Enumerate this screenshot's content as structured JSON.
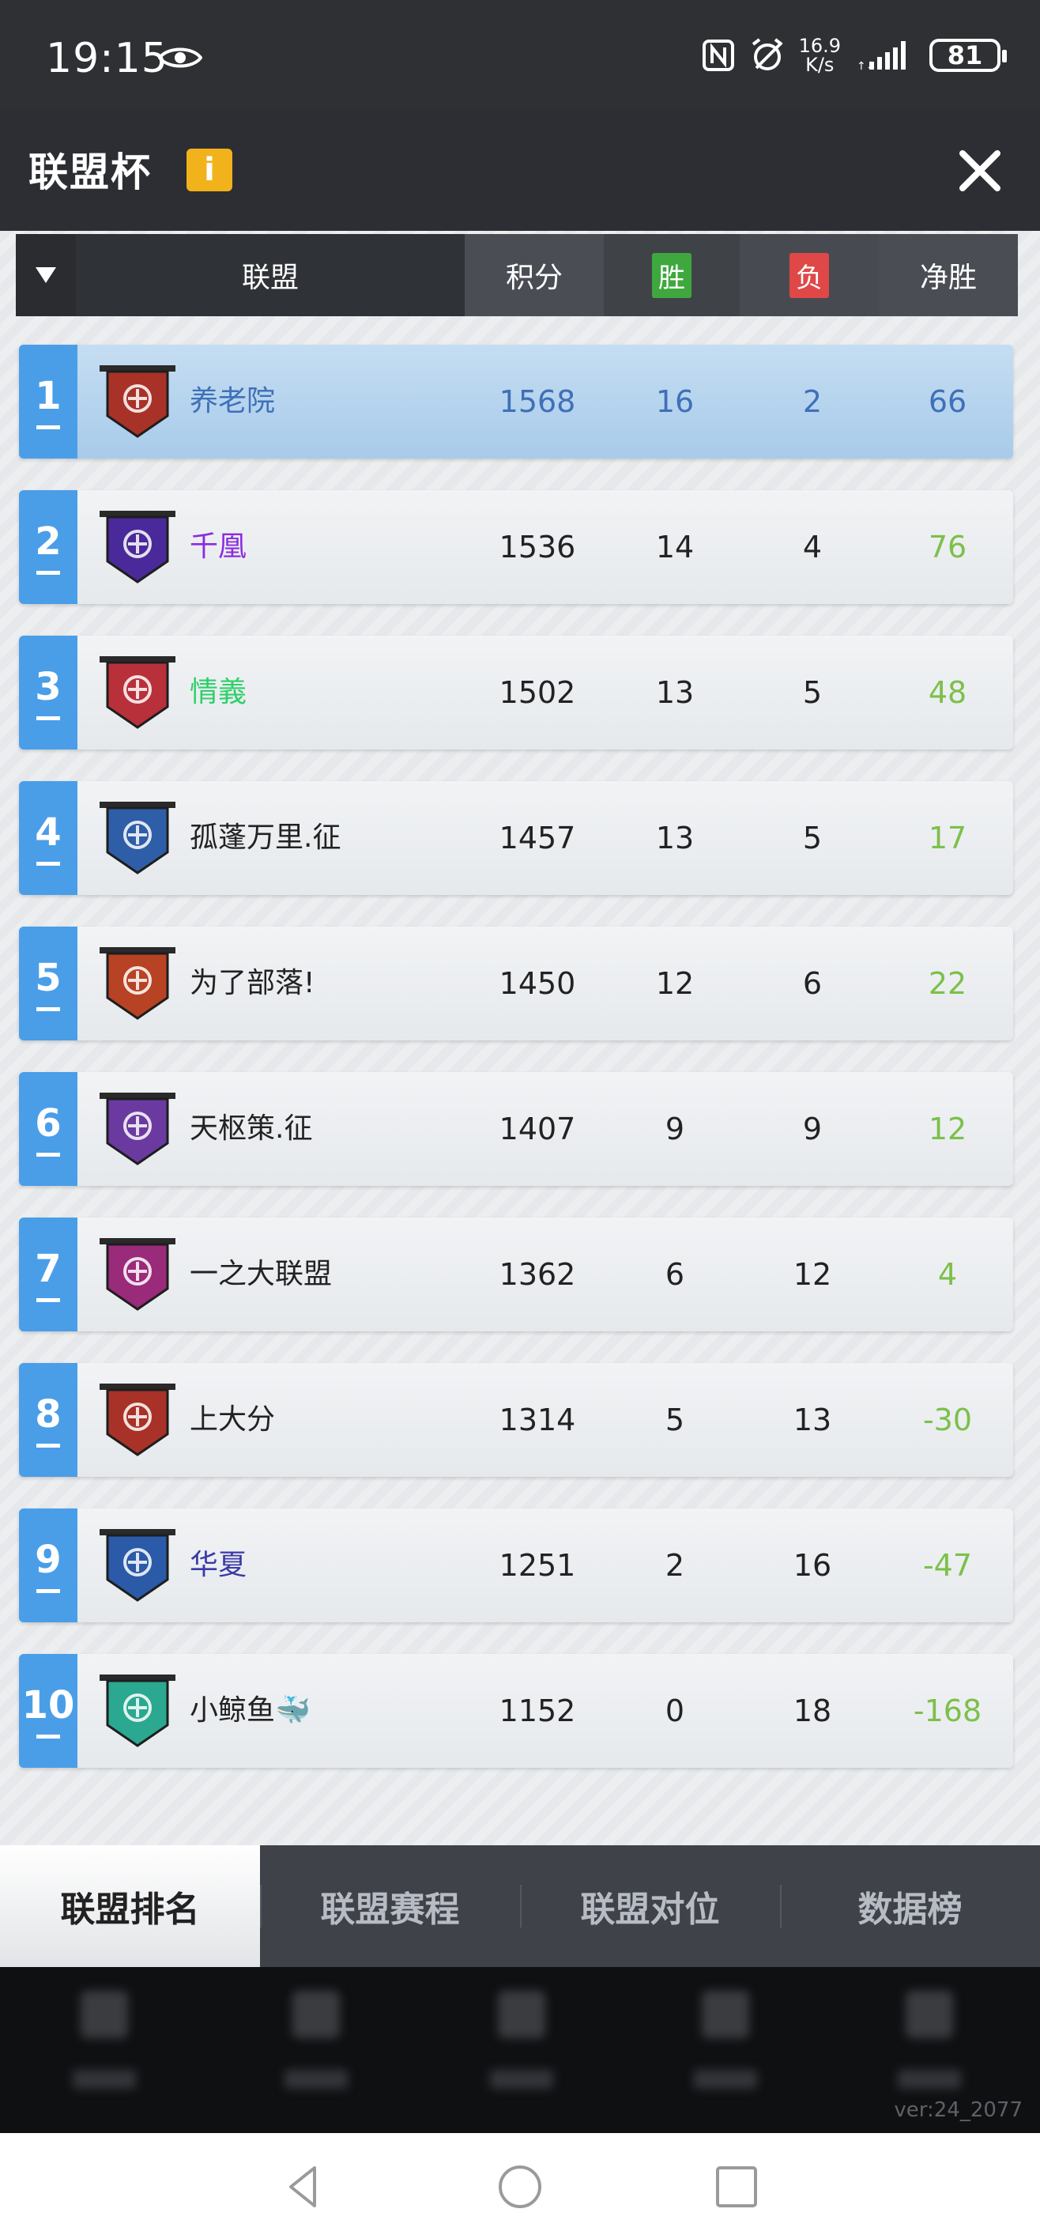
{
  "status_bar": {
    "time": "19:15",
    "speed_value": "16.9",
    "speed_unit": "K/s",
    "battery": "81",
    "icons": [
      "eye-icon",
      "nfc-icon",
      "alarm-icon",
      "signal-icon",
      "battery-icon"
    ]
  },
  "header": {
    "title": "联盟杯",
    "info_label": "i"
  },
  "columns": {
    "alliance": "联盟",
    "score": "积分",
    "win": "胜",
    "loss": "负",
    "net": "净胜"
  },
  "rows": [
    {
      "rank": "1",
      "name": "养老院",
      "score": "1568",
      "win": "16",
      "loss": "2",
      "net": "66"
    },
    {
      "rank": "2",
      "name": "千凰",
      "score": "1536",
      "win": "14",
      "loss": "4",
      "net": "76"
    },
    {
      "rank": "3",
      "name": "情義",
      "score": "1502",
      "win": "13",
      "loss": "5",
      "net": "48"
    },
    {
      "rank": "4",
      "name": "孤蓬万里.征",
      "score": "1457",
      "win": "13",
      "loss": "5",
      "net": "17"
    },
    {
      "rank": "5",
      "name": "为了部落!",
      "score": "1450",
      "win": "12",
      "loss": "6",
      "net": "22"
    },
    {
      "rank": "6",
      "name": "天枢策.征",
      "score": "1407",
      "win": "9",
      "loss": "9",
      "net": "12"
    },
    {
      "rank": "7",
      "name": "一之大联盟",
      "score": "1362",
      "win": "6",
      "loss": "12",
      "net": "4"
    },
    {
      "rank": "8",
      "name": "上大分",
      "score": "1314",
      "win": "5",
      "loss": "13",
      "net": "-30"
    },
    {
      "rank": "9",
      "name": "华夏",
      "score": "1251",
      "win": "2",
      "loss": "16",
      "net": "-47"
    },
    {
      "rank": "10",
      "name": "小鲸鱼🐳",
      "score": "1152",
      "win": "0",
      "loss": "18",
      "net": "-168"
    }
  ],
  "name_colors": [
    "#3f70b8",
    "#8a2be2",
    "#2ed06a",
    "#222222",
    "#222222",
    "#222222",
    "#222222",
    "#222222",
    "#3a3aa8",
    "#222222"
  ],
  "emblem_colors": [
    "#a83228",
    "#4a2a9a",
    "#b8303a",
    "#2f5ea8",
    "#b84224",
    "#6a3aa0",
    "#9a2a7a",
    "#a83228",
    "#2a5aa8",
    "#2aa890"
  ],
  "tabs": [
    "联盟排名",
    "联盟赛程",
    "联盟对位",
    "数据榜"
  ],
  "version": "ver:24_2077"
}
